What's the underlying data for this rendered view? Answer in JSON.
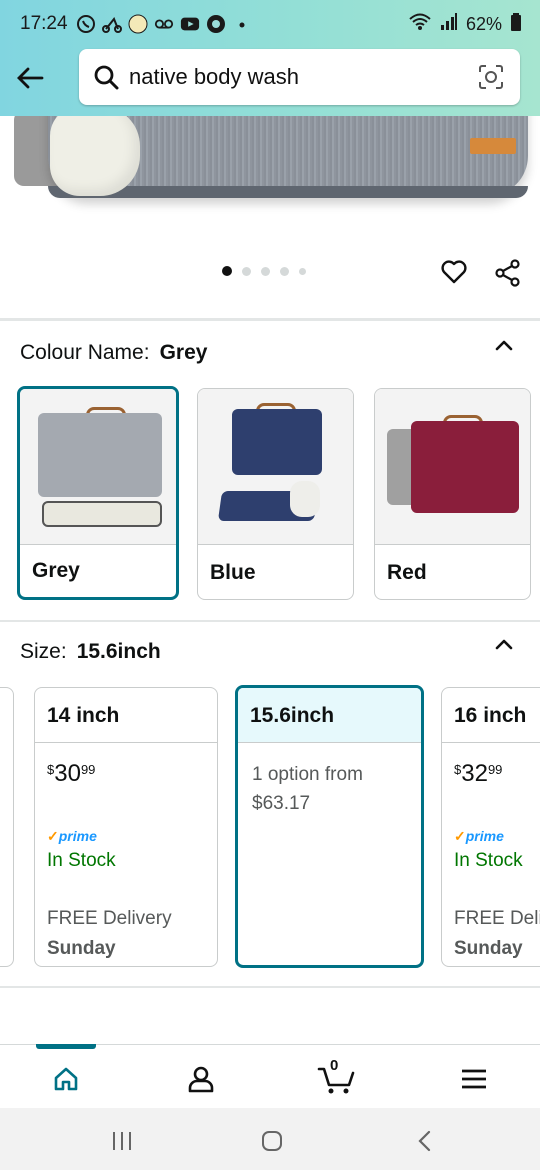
{
  "status": {
    "time": "17:24",
    "battery": "62%"
  },
  "search": {
    "query": "native body wash"
  },
  "carousel": {
    "dot_count": 5,
    "active_index": 0
  },
  "colour": {
    "label": "Colour Name:",
    "selected": "Grey",
    "options": [
      {
        "label": "Grey",
        "color": "#9aa1aa"
      },
      {
        "label": "Blue",
        "color": "#2e3f6e"
      },
      {
        "label": "Red",
        "color": "#8a1e3b"
      }
    ]
  },
  "size": {
    "label": "Size:",
    "selected": "15.6inch",
    "options": [
      {
        "name": "14 inch",
        "price_whole": "30",
        "price_fraction": "99",
        "prime": "prime",
        "stock": "In Stock",
        "delivery": "FREE Delivery",
        "delivery_day": "Sunday"
      },
      {
        "name": "15.6inch",
        "option_line1": "1 option from",
        "option_line2": "$63.17"
      },
      {
        "name": "16 inch",
        "price_whole": "32",
        "price_fraction": "99",
        "prime": "prime",
        "stock": "In Stock",
        "delivery": "FREE Delivery",
        "delivery_day": "Sunday"
      }
    ]
  },
  "bottom_nav": {
    "cart_count": "0"
  },
  "colors": {
    "accent": "#007185",
    "in_stock": "#007600",
    "prime": "#1a98ff"
  }
}
